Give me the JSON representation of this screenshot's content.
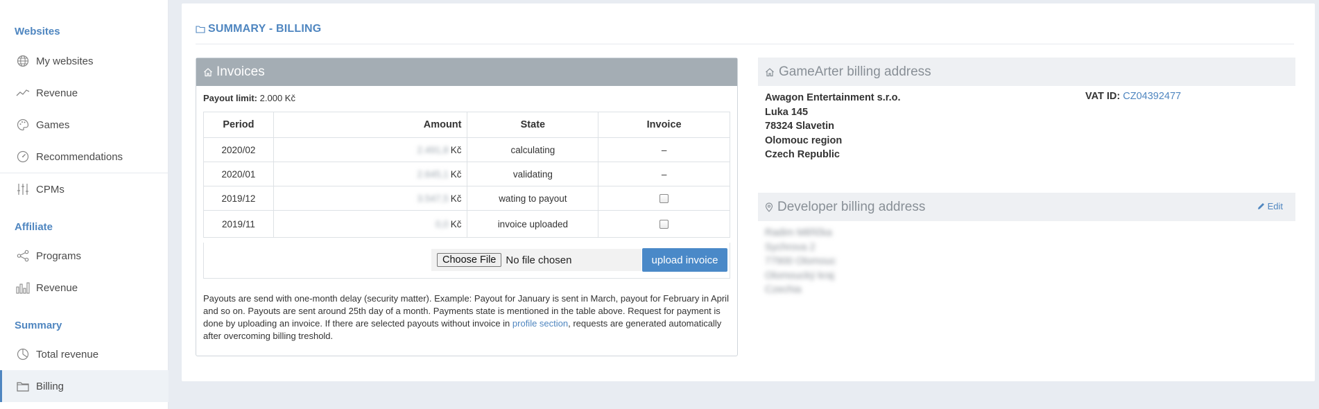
{
  "sidebar": {
    "sections": [
      {
        "label": "Websites"
      },
      {
        "label": "Affiliate"
      },
      {
        "label": "Summary"
      }
    ],
    "items": [
      {
        "label": "My websites",
        "icon": "globe-icon"
      },
      {
        "label": "Revenue",
        "icon": "trend-line-icon"
      },
      {
        "label": "Games",
        "icon": "palette-icon"
      },
      {
        "label": "Recommendations",
        "icon": "gauge-icon"
      },
      {
        "label": "CPMs",
        "icon": "sliders-icon"
      },
      {
        "label": "Programs",
        "icon": "share-icon"
      },
      {
        "label": "Revenue",
        "icon": "bar-chart-icon"
      },
      {
        "label": "Total revenue",
        "icon": "pie-chart-icon"
      },
      {
        "label": "Billing",
        "icon": "folder-icon",
        "active": true
      }
    ]
  },
  "page": {
    "title": "SUMMARY - BILLING"
  },
  "invoices": {
    "title": "Invoices",
    "payout_limit_label": "Payout limit:",
    "payout_limit_value": "2.000 Kč",
    "columns": [
      "Period",
      "Amount",
      "State",
      "Invoice"
    ],
    "rows": [
      {
        "period": "2020/02",
        "amount": "2.491,8",
        "currency": "Kč",
        "state": "calculating",
        "invoice": "–"
      },
      {
        "period": "2020/01",
        "amount": "2.645,1",
        "currency": "Kč",
        "state": "validating",
        "invoice": "–"
      },
      {
        "period": "2019/12",
        "amount": "3.547,5",
        "currency": "Kč",
        "state": "wating to payout",
        "invoice": "checkbox"
      },
      {
        "period": "2019/11",
        "amount": "0,0",
        "currency": "Kč",
        "state": "invoice uploaded",
        "invoice": "checkbox"
      }
    ],
    "choose_file_label": "Choose File",
    "no_file_label": "No file chosen",
    "upload_label": "upload invoice",
    "note_part1": "Payouts are send with one-month delay (security matter). Example: Payout for January is sent in March, payout for February in April and so on. Payouts are sent around 25th day of a month. Payments state is mentioned in the table above. Request for payment is done by uploading an invoice. If there are selected payouts without invoice in ",
    "note_link": "profile section",
    "note_part2": ", requests are generated automatically after overcoming billing treshold."
  },
  "gamearter_billing": {
    "title": "GameArter billing address",
    "lines": [
      "Awagon Entertainment s.r.o.",
      "Luka 145",
      "78324 Slavetin",
      "Olomouc region",
      "Czech Republic"
    ],
    "vat_label": "VAT ID:",
    "vat_value": "CZ04392477"
  },
  "developer_billing": {
    "title": "Developer billing address",
    "edit_label": "Edit",
    "lines": [
      "Radim Měřička",
      "Sychrova 2",
      "77900 Olomouc",
      "Olomoucký kraj",
      "Czechia"
    ]
  },
  "colors": {
    "accent": "#4f86c0",
    "panel_header": "#a4adb4",
    "upload_button": "#4a89c8",
    "background": "#e8ecf2"
  }
}
